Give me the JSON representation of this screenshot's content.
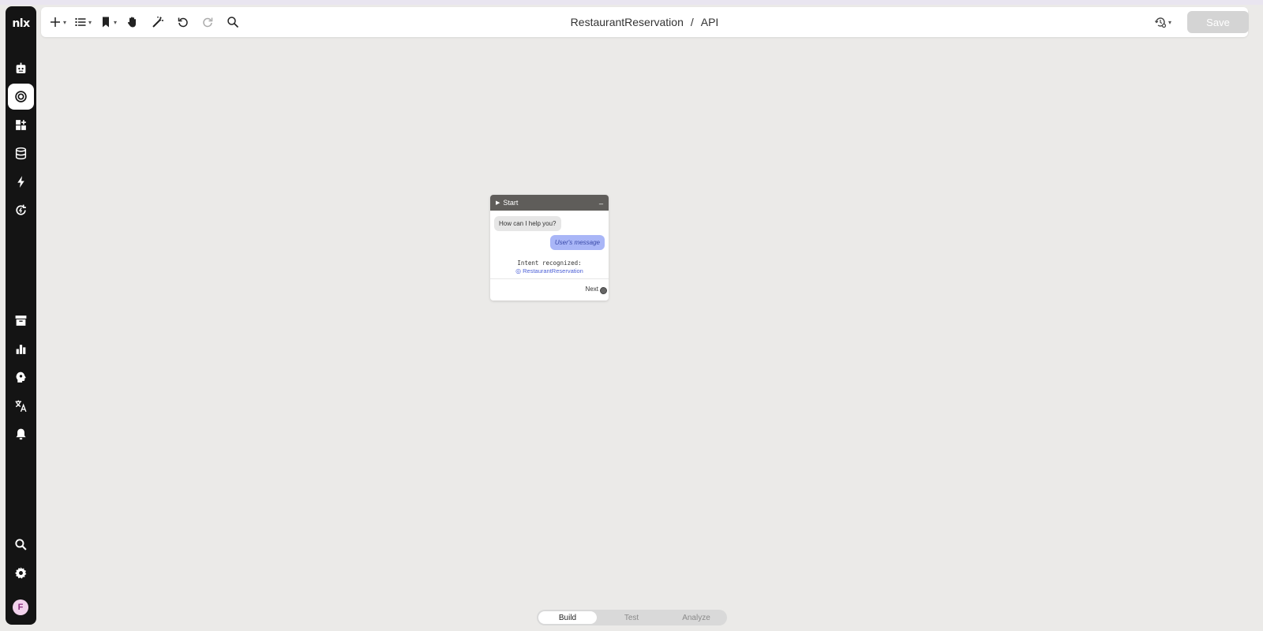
{
  "app": {
    "logo_text": "nlx"
  },
  "sidebar": {
    "items": [
      {
        "name": "sidebar-item-applications",
        "icon": "robot-icon"
      },
      {
        "name": "sidebar-item-intents",
        "icon": "target-icon",
        "active": true
      },
      {
        "name": "sidebar-item-widgets",
        "icon": "dashboard-add-icon"
      },
      {
        "name": "sidebar-item-data",
        "icon": "database-icon"
      },
      {
        "name": "sidebar-item-actions",
        "icon": "lightning-icon"
      },
      {
        "name": "sidebar-item-integrations",
        "icon": "refresh-power-icon"
      },
      {
        "name": "sidebar-item-archive",
        "icon": "archive-icon"
      },
      {
        "name": "sidebar-item-analytics",
        "icon": "bar-chart-icon"
      },
      {
        "name": "sidebar-item-ai",
        "icon": "brain-head-icon"
      },
      {
        "name": "sidebar-item-translations",
        "icon": "translate-icon"
      },
      {
        "name": "sidebar-item-notifications",
        "icon": "bell-icon"
      },
      {
        "name": "sidebar-item-search",
        "icon": "search-icon"
      },
      {
        "name": "sidebar-item-settings",
        "icon": "gear-icon"
      }
    ],
    "avatar_initial": "F"
  },
  "toolbar": {
    "tools": [
      "add-icon",
      "list-icon",
      "bookmark-icon",
      "hand-icon",
      "magic-wand-icon",
      "undo-icon",
      "redo-icon",
      "search-icon"
    ],
    "breadcrumb": {
      "project": "RestaurantReservation",
      "separator": "/",
      "page": "API"
    },
    "save_label": "Save"
  },
  "node": {
    "title": "Start",
    "minimize_label": "_",
    "bot_message": "How can I help you?",
    "user_message": "User's message",
    "intent_label": "Intent recognized:",
    "intent_value": "RestaurantReservation",
    "next_label": "Next"
  },
  "modes": {
    "items": [
      "Build",
      "Test",
      "Analyze"
    ],
    "active": "Build"
  },
  "colors": {
    "canvas": "#ebeae8",
    "sidebar": "#141414",
    "node_header": "#5f5d5a",
    "user_bubble": "#a9b6f7",
    "intent_link": "#4b5fd6",
    "save_disabled": "#d4d4d4"
  }
}
